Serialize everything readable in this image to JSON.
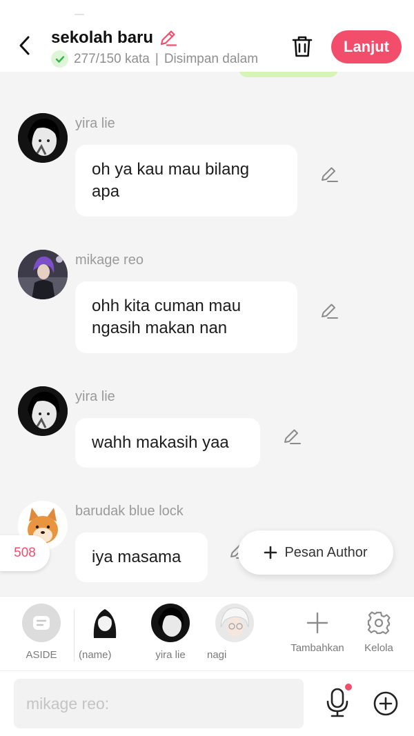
{
  "header": {
    "title": "sekolah baru",
    "word_count": "277/150 kata",
    "separator": "|",
    "save_status": "Disimpan dalam",
    "next_label": "Lanjut",
    "accent_color": "#f24e6c"
  },
  "messages": [
    {
      "sender": "yira lie",
      "text": "oh ya kau mau bilang apa"
    },
    {
      "sender": "mikage reo",
      "text": "ohh kita cuman mau ngasih makan nan"
    },
    {
      "sender": "yira lie",
      "text": "wahh makasih yaa"
    },
    {
      "sender": "barudak blue lock",
      "text": "iya masama"
    }
  ],
  "count_badge": "508",
  "author_button": {
    "icon": "plus-icon",
    "label": "Pesan Author"
  },
  "characters": [
    {
      "label": "ASIDE",
      "icon": "aside-icon"
    },
    {
      "label": "(name)"
    },
    {
      "label": "yira lie"
    },
    {
      "label": "nagi"
    },
    {
      "label": "Tambahkan",
      "icon": "plus-icon"
    },
    {
      "label": "Kelola",
      "icon": "gear-icon"
    }
  ],
  "input": {
    "placeholder": "mikage reo:"
  }
}
